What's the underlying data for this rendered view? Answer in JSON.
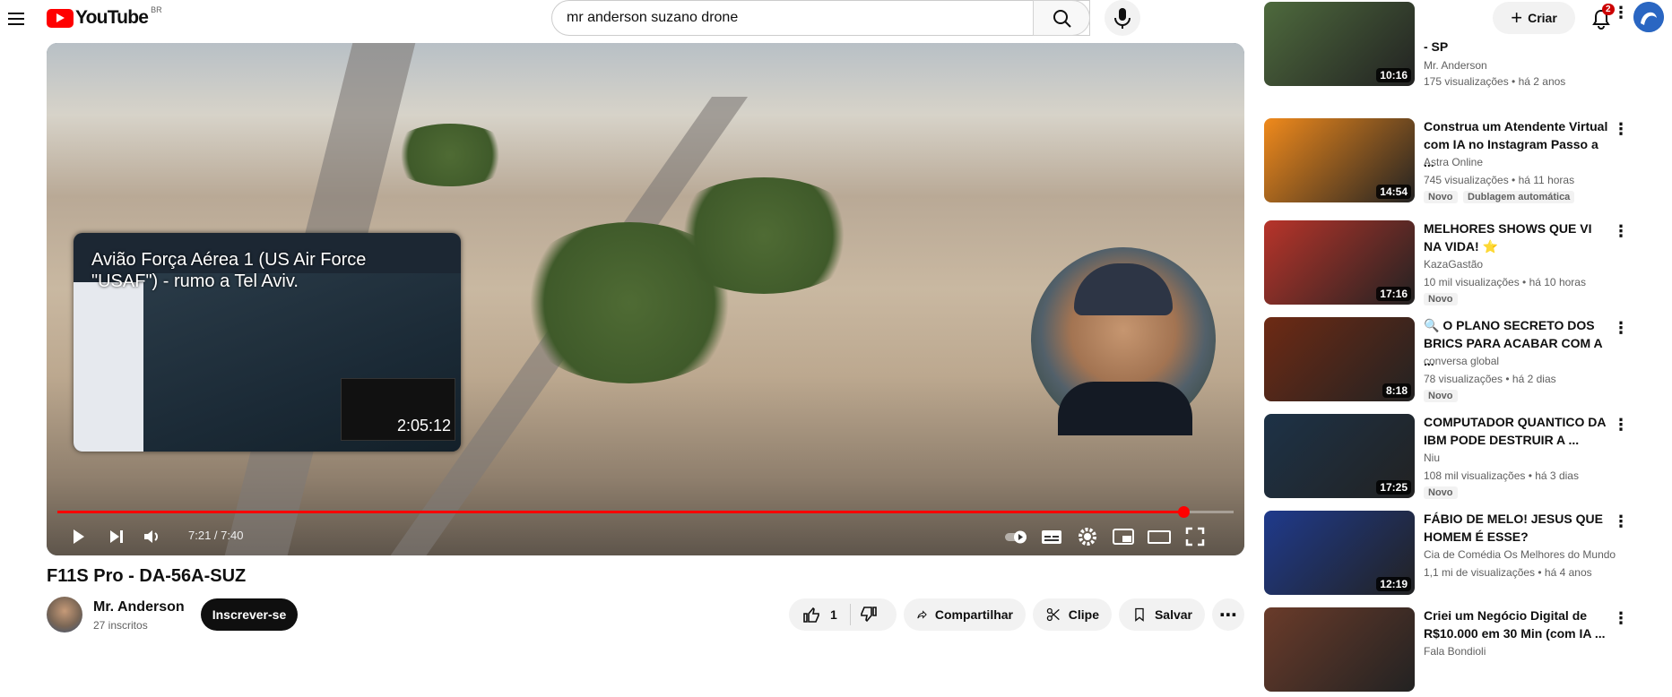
{
  "header": {
    "logo_text": "YouTube",
    "country_code": "BR",
    "search_value": "mr anderson suzano drone",
    "create_label": "Criar",
    "notif_count": "2"
  },
  "player": {
    "overlay_title": "Avião Força Aérea 1 (US Air Force \"USAF\") - rumo a Tel Aviv.",
    "overlay_duration": "2:05:12",
    "time": "7:21 / 7:40",
    "progress": 0.957
  },
  "video": {
    "title": "F11S Pro - DA-56A-SUZ",
    "channel": "Mr. Anderson",
    "subs": "27 inscritos",
    "subscribe": "Inscrever-se",
    "likes": "1",
    "share": "Compartilhar",
    "clip": "Clipe",
    "save": "Salvar"
  },
  "sidebar": [
    {
      "title": "- SP",
      "channel": "Mr. Anderson",
      "meta": "175 visualizações • há 2 anos",
      "duration": "10:16",
      "thumb": "#4e6a3d"
    },
    {
      "title": "Construa um Atendente Virtual com IA no Instagram Passo a ...",
      "channel": "Astra Online",
      "meta": "745 visualizações • há 11 horas",
      "duration": "14:54",
      "badge": "Novo",
      "dub": "Dublagem automática",
      "thumb": "#f08a1c"
    },
    {
      "title": "MELHORES SHOWS QUE VI NA VIDA! ⭐",
      "channel": "KazaGastão",
      "meta": "10 mil visualizações • há 10 horas",
      "duration": "17:16",
      "badge": "Novo",
      "thumb": "#b8342a"
    },
    {
      "title": "🔍 O PLANO SECRETO DOS BRICS PARA ACABAR COM A ...",
      "channel": "conversa global",
      "meta": "78 visualizações • há 2 dias",
      "duration": "8:18",
      "badge": "Novo",
      "thumb": "#6e2a14"
    },
    {
      "title": "COMPUTADOR QUANTICO DA IBM PODE DESTRUIR A ...",
      "channel": "Niu",
      "meta": "108 mil visualizações • há 3 dias",
      "duration": "17:25",
      "badge": "Novo",
      "thumb": "#1d3247"
    },
    {
      "title": "FÁBIO DE MELO! JESUS QUE HOMEM É ESSE?",
      "channel": "Cia de Comédia Os Melhores do Mundo",
      "meta": "1,1 mi de visualizações • há 4 anos",
      "duration": "12:19",
      "thumb": "#1f3a8c"
    },
    {
      "title": "Criei um Negócio Digital de R$10.000 em 30 Min (com IA ...",
      "channel": "Fala Bondioli",
      "meta": "",
      "duration": "",
      "thumb": "#6a3b2a"
    }
  ]
}
